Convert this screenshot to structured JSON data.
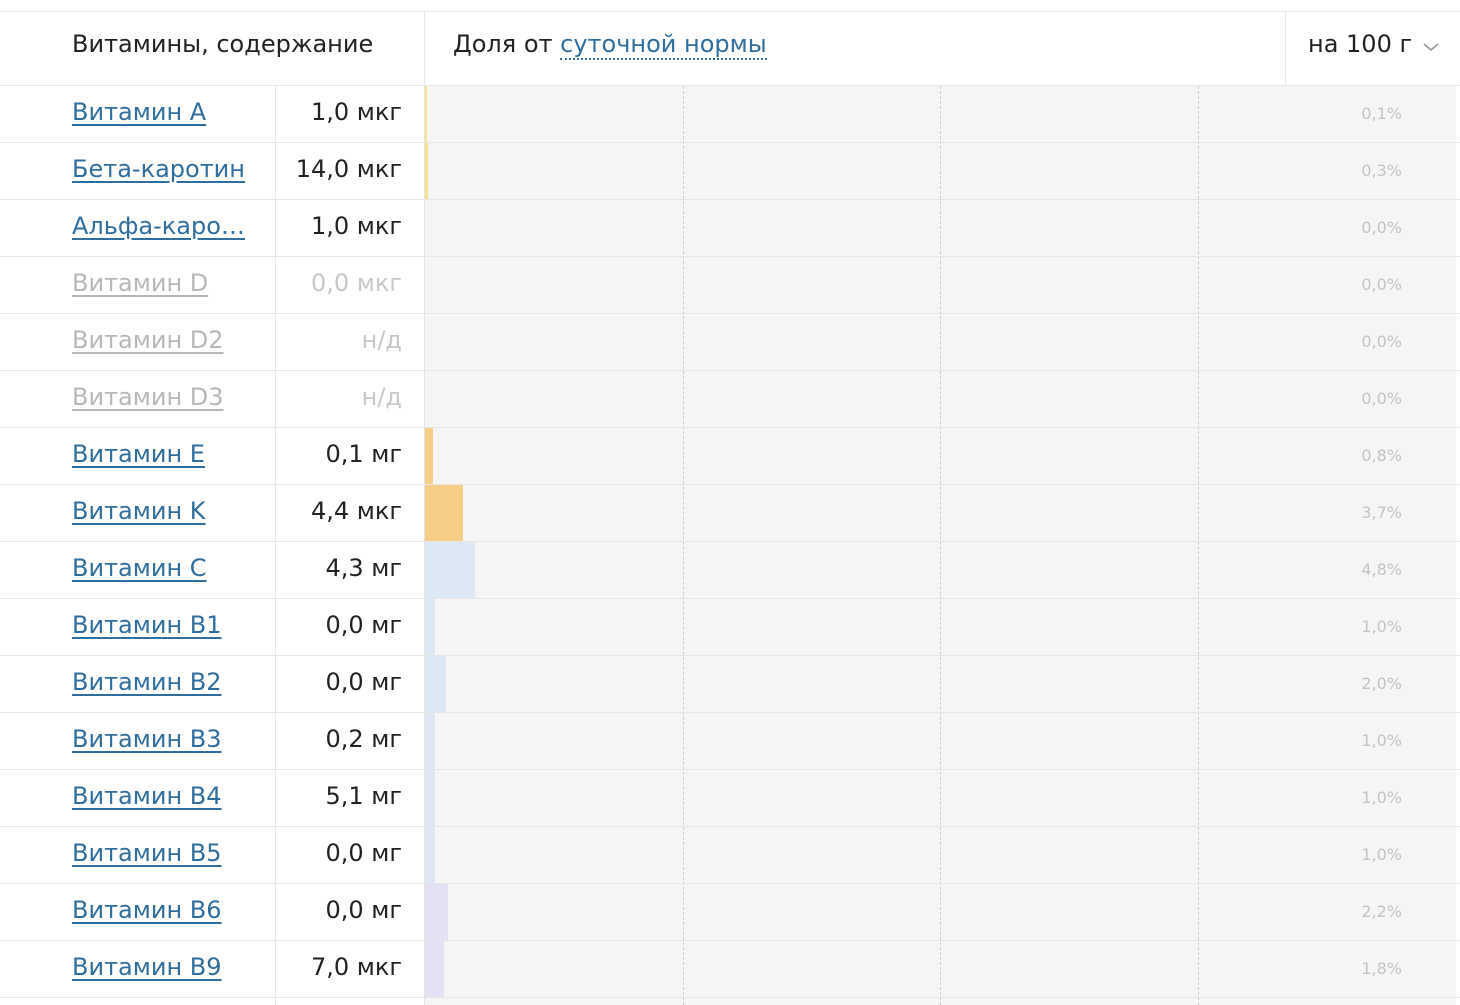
{
  "header": {
    "left_title": "Витамины, содержание",
    "share_prefix": "Доля от",
    "share_link": "суточной нормы",
    "per_select": "на 100 г"
  },
  "rows": [
    {
      "name": "Витамин A",
      "value": "1,0 мкг",
      "percent": "0,1%",
      "share": 0.1,
      "color": "#f5e58a",
      "na": false
    },
    {
      "name": "Бета-каротин",
      "value": "14,0 мкг",
      "percent": "0,3%",
      "share": 0.3,
      "color": "#f5e58a",
      "na": false
    },
    {
      "name": "Альфа-каро…",
      "value": "1,0 мкг",
      "percent": "0,0%",
      "share": 0,
      "color": "#f5e58a",
      "na": false
    },
    {
      "name": "Витамин D",
      "value": "0,0 мкг",
      "percent": "0,0%",
      "share": 0,
      "color": "#f5e58a",
      "na": true
    },
    {
      "name": "Витамин D2",
      "value": "н/д",
      "percent": "0,0%",
      "share": 0,
      "color": "#f5e58a",
      "na": true
    },
    {
      "name": "Витамин D3",
      "value": "н/д",
      "percent": "0,0%",
      "share": 0,
      "color": "#f5e58a",
      "na": true
    },
    {
      "name": "Витамин E",
      "value": "0,1 мг",
      "percent": "0,8%",
      "share": 0.8,
      "color": "#f6ce86",
      "na": false
    },
    {
      "name": "Витамин K",
      "value": "4,4 мкг",
      "percent": "3,7%",
      "share": 3.7,
      "color": "#f6ce86",
      "na": false
    },
    {
      "name": "Витамин C",
      "value": "4,3 мг",
      "percent": "4,8%",
      "share": 4.8,
      "color": "#dce9f4",
      "na": false
    },
    {
      "name": "Витамин B1",
      "value": "0,0 мг",
      "percent": "1,0%",
      "share": 1.0,
      "color": "#dce9f4",
      "na": false
    },
    {
      "name": "Витамин B2",
      "value": "0,0 мг",
      "percent": "2,0%",
      "share": 2.0,
      "color": "#dce9f4",
      "na": false
    },
    {
      "name": "Витамин B3",
      "value": "0,2 мг",
      "percent": "1,0%",
      "share": 1.0,
      "color": "#dfe6f4",
      "na": false
    },
    {
      "name": "Витамин B4",
      "value": "5,1 мг",
      "percent": "1,0%",
      "share": 1.0,
      "color": "#dfe6f4",
      "na": false
    },
    {
      "name": "Витамин B5",
      "value": "0,0 мг",
      "percent": "1,0%",
      "share": 1.0,
      "color": "#dfe6f4",
      "na": false
    },
    {
      "name": "Витамин B6",
      "value": "0,0 мг",
      "percent": "2,2%",
      "share": 2.2,
      "color": "#e2e2f4",
      "na": false
    },
    {
      "name": "Витамин B9",
      "value": "7,0 мкг",
      "percent": "1,8%",
      "share": 1.8,
      "color": "#e2e2f4",
      "na": false
    }
  ]
}
